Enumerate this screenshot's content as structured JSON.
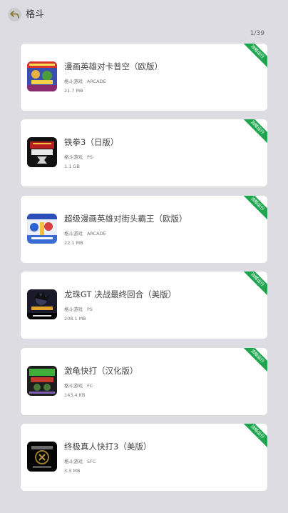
{
  "header": {
    "title": "格斗",
    "back_icon": "back-arrow-icon"
  },
  "page_counter": "1/39",
  "colors": {
    "background": "#dcdce2",
    "card": "#ffffff",
    "badge": "#1ea64f"
  },
  "games": [
    {
      "title": "漫画英雄对卡普空（欧版）",
      "category": "格斗游戏",
      "platform": "ARCADE",
      "size": "21.7 MB",
      "badge": "流畅运行",
      "thumbnail": "marvel-vs-capcom-cover"
    },
    {
      "title": "铁拳3（日版）",
      "category": "格斗游戏",
      "platform": "PS",
      "size": "1.1 GB",
      "badge": "流畅运行",
      "thumbnail": "tekken-3-cover"
    },
    {
      "title": "超级漫画英雄对街头霸王（欧版）",
      "category": "格斗游戏",
      "platform": "ARCADE",
      "size": "22.1 MB",
      "badge": "流畅运行",
      "thumbnail": "marvel-super-heroes-vs-street-fighter-cover"
    },
    {
      "title": "龙珠GT 决战最终回合（美版）",
      "category": "格斗游戏",
      "platform": "PS",
      "size": "208.1 MB",
      "badge": "流畅运行",
      "thumbnail": "dragon-ball-gt-final-bout-cover"
    },
    {
      "title": "激龟快打（汉化版）",
      "category": "格斗游戏",
      "platform": "FC",
      "size": "143.4 KB",
      "badge": "流畅运行",
      "thumbnail": "tmnt-tournament-fighters-cover"
    },
    {
      "title": "终极真人快打3（美版）",
      "category": "格斗游戏",
      "platform": "SFC",
      "size": "3.3 MB",
      "badge": "流畅运行",
      "thumbnail": "ultimate-mortal-kombat-3-cover"
    }
  ]
}
